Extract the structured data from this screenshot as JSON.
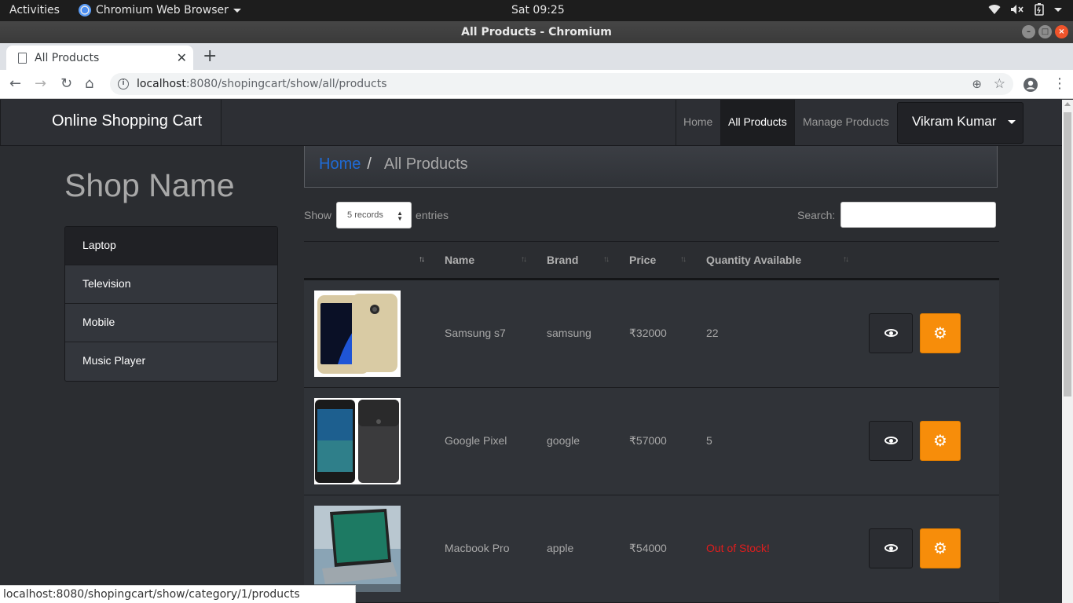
{
  "os": {
    "activities": "Activities",
    "app_name": "Chromium Web Browser",
    "clock": "Sat 09:25",
    "tray_icons": [
      "wifi-icon",
      "volume-muted-icon",
      "battery-icon",
      "power-menu-icon"
    ]
  },
  "window": {
    "title": "All Products - Chromium"
  },
  "browser": {
    "tab_title": "All Products",
    "url_host": "localhost",
    "url_rest": ":8080/shopingcart/show/all/products",
    "status_url": "localhost:8080/shopingcart/show/category/1/products"
  },
  "navbar": {
    "brand": "Online Shopping Cart",
    "links": {
      "home": "Home",
      "all_products": "All Products",
      "manage_products": "Manage Products"
    },
    "user": "Vikram Kumar"
  },
  "sidebar": {
    "shop_name": "Shop Name",
    "categories": [
      {
        "label": "Laptop"
      },
      {
        "label": "Television"
      },
      {
        "label": "Mobile"
      },
      {
        "label": "Music Player"
      }
    ]
  },
  "breadcrumb": {
    "home": "Home",
    "separator": "/",
    "current": "All Products"
  },
  "table_controls": {
    "show": "Show",
    "length_value": "5 records",
    "entries": "entries",
    "search_label": "Search:"
  },
  "table": {
    "columns": [
      "Name",
      "Brand",
      "Price",
      "Quantity Available"
    ],
    "rows": [
      {
        "name": "Samsung s7",
        "brand": "samsung",
        "price": "₹32000",
        "quantity": "22"
      },
      {
        "name": "Google Pixel",
        "brand": "google",
        "price": "₹57000",
        "quantity": "5"
      },
      {
        "name": "Macbook Pro",
        "brand": "apple",
        "price": "₹54000",
        "quantity": "Out of Stock!"
      }
    ]
  },
  "colors": {
    "page_bg": "#2b2d31",
    "accent_orange": "#f78d0a",
    "link_blue": "#1f6bd6",
    "out_of_stock_red": "#e01d1d"
  }
}
